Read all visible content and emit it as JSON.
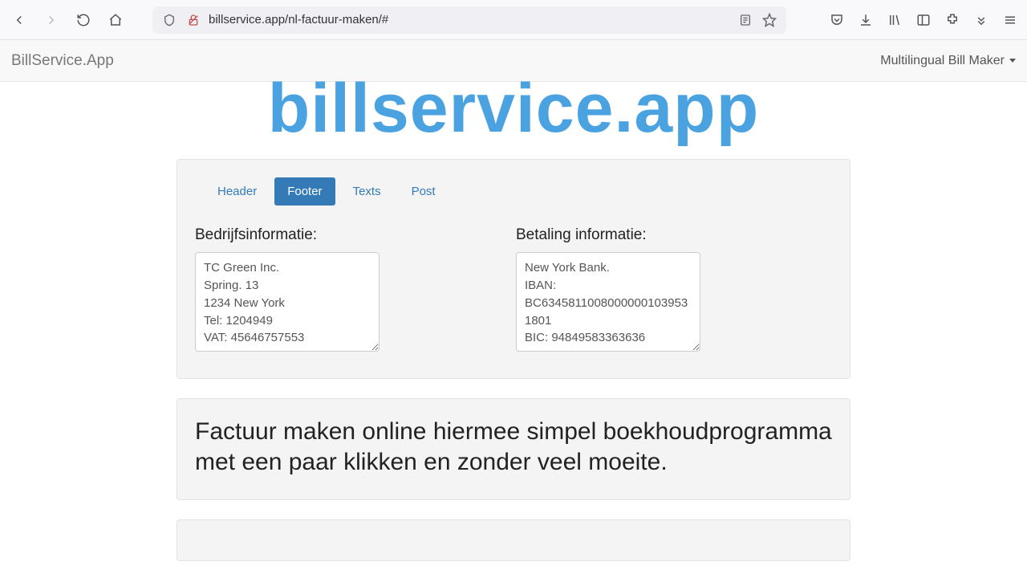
{
  "browser": {
    "url_display": "billservice.app/nl-factuur-maken/#",
    "url_domain": "billservice.app"
  },
  "navbar": {
    "brand": "BillService.App",
    "menu": "Multilingual Bill Maker"
  },
  "hero": "billservice.app",
  "tabs": [
    {
      "label": "Header",
      "active": false
    },
    {
      "label": "Footer",
      "active": true
    },
    {
      "label": "Texts",
      "active": false
    },
    {
      "label": "Post",
      "active": false
    }
  ],
  "footer_form": {
    "company_label": "Bedrijfsinformatie:",
    "company_value": "TC Green Inc.\nSpring. 13\n1234 New York\nTel: 1204949\nVAT: 45646757553",
    "payment_label": "Betaling informatie:",
    "payment_value": "New York Bank.\nIBAN: BC63458110080000001039531801\nBIC: 94849583363636"
  },
  "description": "Factuur maken online hiermee simpel boekhoudprogramma met een paar klikken en zonder veel moeite."
}
